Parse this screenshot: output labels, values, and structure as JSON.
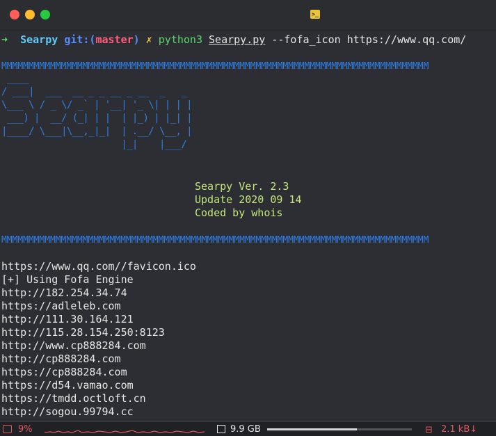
{
  "prompt": {
    "arrow": "➜",
    "dir": "Searpy",
    "git_prefix": "git:(",
    "branch": "master",
    "git_suffix": ")",
    "dirty": "✗",
    "command": "python3",
    "script": "Searpy.py",
    "args": "--fofa_icon https://www.qq.com/"
  },
  "banner": {
    "rule": "MMMMMMMMMMMMMMMMMMMMMMMMMMMMMMMMMMMMMMMMMMMMMMMMMMMMMMMMMMMMMMMMMMMMMMMMMMMMMMM",
    "logo": [
      " ____",
      "/ ___|  ___  __ _ _ __ _ __  _   _",
      "\\___ \\ / _ \\/ _` | '__| '_ \\| | | |",
      " ___) |  __/ (_| | |  | |_) | |_| |",
      "|____/ \\___|\\__,_|_|  | .__/ \\__, |",
      "                      |_|    |___/"
    ],
    "version": "Searpy Ver. 2.3",
    "update": "Update 2020 09 14",
    "coded": "Coded by whois"
  },
  "output": [
    "https://www.qq.com//favicon.ico",
    "[+] Using Fofa Engine",
    "http://182.254.34.74",
    "https://adleleb.com",
    "http://111.30.164.121",
    "http://115.28.154.250:8123",
    "http://www.cp888284.com",
    "http://cp888284.com",
    "https://cp888284.com",
    "https://d54.vamao.com",
    "https://tmdd.octloft.cn",
    "http://sogou.99794.cc"
  ],
  "status": {
    "cpu": "9%",
    "memory": "9.9 GB",
    "memory_used_fraction": 0.62,
    "network": "2.1 kB↓"
  },
  "colors": {
    "banner": "#2f7ee8",
    "info": "#c5e77c",
    "alert": "#e0565b"
  },
  "icons": {
    "terminal": "terminal-icon",
    "cpu": "cpu-icon",
    "memory": "memory-icon",
    "network": "network-icon"
  }
}
